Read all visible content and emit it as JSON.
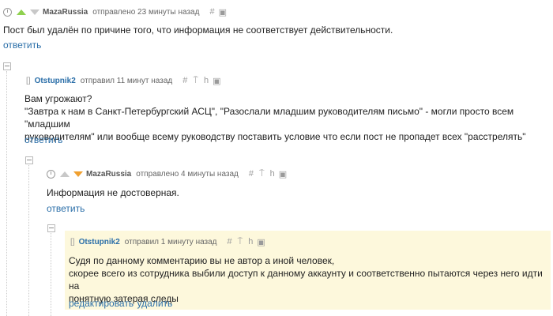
{
  "colors": {
    "link": "#2a6ea8",
    "vote_up": "#8fd14f",
    "vote_down": "#f0a030",
    "highlight": "#fdf8dc"
  },
  "comments": [
    {
      "author": "MazaRussia",
      "meta": "отправлено 23 минуты назад",
      "text": "Пост был удалён по причине того, что информация не соответствует действительности.",
      "actions": [
        "ответить"
      ]
    },
    {
      "author": "Otstupnik2",
      "meta": "отправил 11 минут назад",
      "text_lines": [
        "Вам угрожают?",
        "\"Завтра к нам в Санкт-Петербургский АСЦ\", \"Разослали младшим руководителям письмо\" - могли просто всем \"младшим",
        "руководителям\" или вообще всему руководству поставить условие что если пост не пропадет всех \"расстрелять\""
      ],
      "actions": [
        "ответить"
      ]
    },
    {
      "author": "MazaRussia",
      "meta": "отправлено 4 минуты назад",
      "text": "Информация не достоверная.",
      "actions": [
        "ответить"
      ]
    },
    {
      "author": "Otstupnik2",
      "meta": "отправил 1 минуту назад",
      "text_lines": [
        "Судя по данному комментарию вы не автор а иной человек,",
        "скорее всего из сотрудника выбили доступ к данному аккаунту и соответственно пытаются через него идти на",
        "понятную затерая следы"
      ],
      "actions": [
        "редактировать",
        "удалить"
      ]
    }
  ],
  "icons": {
    "clock": "clock-icon",
    "hash": "#",
    "pin": "⍑",
    "save": "save-icon"
  }
}
